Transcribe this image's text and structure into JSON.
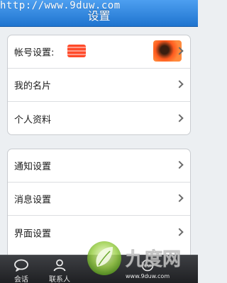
{
  "header": {
    "watermark_url": "http://www.9duw.com",
    "title": "设置"
  },
  "group1": {
    "items": [
      {
        "label": "帐号设置:"
      },
      {
        "label": "我的名片"
      },
      {
        "label": "个人资料"
      }
    ]
  },
  "group2": {
    "items": [
      {
        "label": "通知设置"
      },
      {
        "label": "消息设置"
      },
      {
        "label": "界面设置"
      }
    ]
  },
  "tabbar": {
    "tabs": [
      {
        "label": "会话",
        "icon": "chat-bubble-icon"
      },
      {
        "label": "联系人",
        "icon": "person-icon"
      }
    ]
  },
  "watermark_logo": {
    "text": "九度网",
    "url": "www.9duw.com"
  },
  "colors": {
    "titlebar": "#1f74cf",
    "background": "#eceff2",
    "tabbar": "#2a2b2e"
  }
}
